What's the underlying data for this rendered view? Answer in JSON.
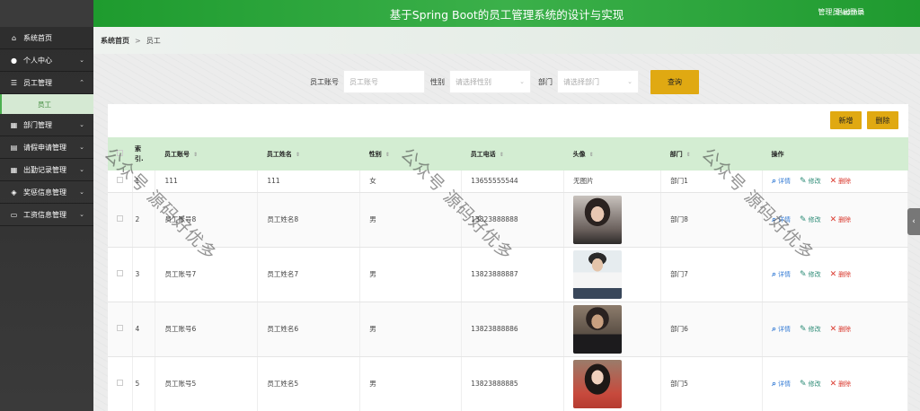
{
  "header": {
    "title": "基于Spring Boot的员工管理系统的设计与实现",
    "user": "管理员 admin",
    "logout": "退出登录"
  },
  "sidebar": {
    "items": [
      {
        "label": "系统首页",
        "icon": "home-icon",
        "chevron": false
      },
      {
        "label": "个人中心",
        "icon": "user-icon",
        "chevron": true
      },
      {
        "label": "员工管理",
        "icon": "list-icon",
        "chevron": true,
        "expanded": true
      },
      {
        "label": "部门管理",
        "icon": "grid-icon",
        "chevron": true
      },
      {
        "label": "请假申请管理",
        "icon": "calendar-icon",
        "chevron": true
      },
      {
        "label": "出勤记录管理",
        "icon": "grid-icon",
        "chevron": true
      },
      {
        "label": "奖惩信息管理",
        "icon": "tag-icon",
        "chevron": true
      },
      {
        "label": "工资信息管理",
        "icon": "monitor-icon",
        "chevron": true
      }
    ],
    "sub_item": "员工"
  },
  "breadcrumb": {
    "home": "系统首页",
    "sep": ">",
    "current": "员工"
  },
  "search": {
    "account_label": "员工账号",
    "account_placeholder": "员工账号",
    "gender_label": "性别",
    "gender_placeholder": "请选择性别",
    "dept_label": "部门",
    "dept_placeholder": "请选择部门",
    "query_button": "查询"
  },
  "actions": {
    "add": "新增",
    "delete": "删除"
  },
  "table": {
    "columns": [
      "索引",
      "员工账号",
      "员工姓名",
      "性别",
      "员工电话",
      "头像",
      "部门",
      "操作"
    ],
    "index_header": "索\n引.",
    "rows": [
      {
        "index": "1",
        "account": "111",
        "name": "111",
        "gender": "女",
        "phone": "13655555544",
        "avatar": "无图片",
        "dept": "部门1"
      },
      {
        "index": "2",
        "account": "员工账号8",
        "name": "员工姓名8",
        "gender": "男",
        "phone": "13823888888",
        "avatar": "",
        "dept": "部门8"
      },
      {
        "index": "3",
        "account": "员工账号7",
        "name": "员工姓名7",
        "gender": "男",
        "phone": "13823888887",
        "avatar": "",
        "dept": "部门7"
      },
      {
        "index": "4",
        "account": "员工账号6",
        "name": "员工姓名6",
        "gender": "男",
        "phone": "13823888886",
        "avatar": "",
        "dept": "部门6"
      },
      {
        "index": "5",
        "account": "员工账号5",
        "name": "员工姓名5",
        "gender": "男",
        "phone": "13823888885",
        "avatar": "",
        "dept": "部门5"
      }
    ],
    "ops": {
      "detail": "详情",
      "edit": "修改",
      "delete": "删除"
    }
  },
  "watermark": "公众号 源码好优多"
}
